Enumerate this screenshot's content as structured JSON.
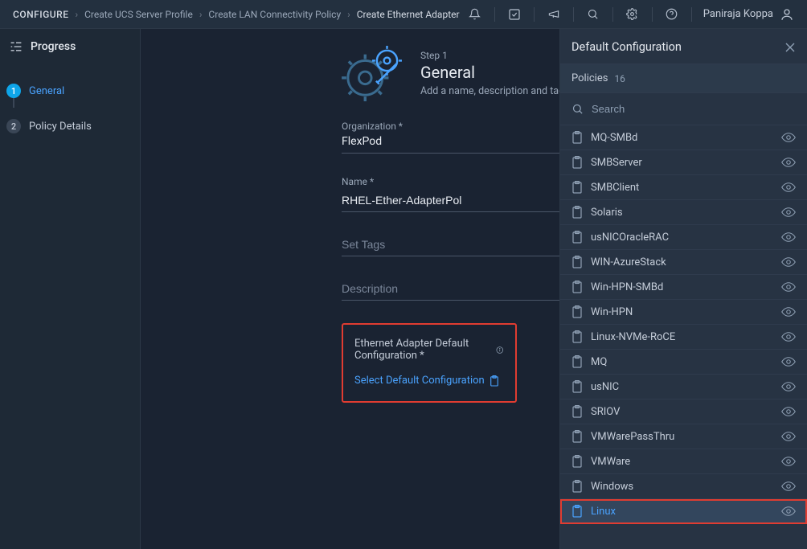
{
  "breadcrumb": {
    "configure": "CONFIGURE",
    "ucs": "Create UCS Server Profile",
    "lan": "Create LAN Connectivity Policy",
    "eth": "Create Ethernet Adapter"
  },
  "user": {
    "name": "Paniraja Koppa"
  },
  "sidebar": {
    "title": "Progress",
    "steps": [
      {
        "num": "1",
        "label": "General"
      },
      {
        "num": "2",
        "label": "Policy Details"
      }
    ]
  },
  "form": {
    "stepnum": "Step 1",
    "steptitle": "General",
    "stepdesc": "Add a name, description and tag for the policy.",
    "org_label": "Organization *",
    "org_value": "FlexPod",
    "name_label": "Name *",
    "name_value": "RHEL-Ether-AdapterPol",
    "tags_placeholder": "Set Tags",
    "desc_placeholder": "Description",
    "adapter_label": "Ethernet Adapter Default Configuration *",
    "adapter_link": "Select Default Configuration"
  },
  "drawer": {
    "title": "Default Configuration",
    "subtab": "Policies",
    "count": "16",
    "search_placeholder": "Search",
    "items": [
      "MQ-SMBd",
      "SMBServer",
      "SMBClient",
      "Solaris",
      "usNICOracleRAC",
      "WIN-AzureStack",
      "Win-HPN-SMBd",
      "Win-HPN",
      "Linux-NVMe-RoCE",
      "MQ",
      "usNIC",
      "SRIOV",
      "VMWarePassThru",
      "VMWare",
      "Windows",
      "Linux"
    ],
    "selected": "Linux"
  }
}
